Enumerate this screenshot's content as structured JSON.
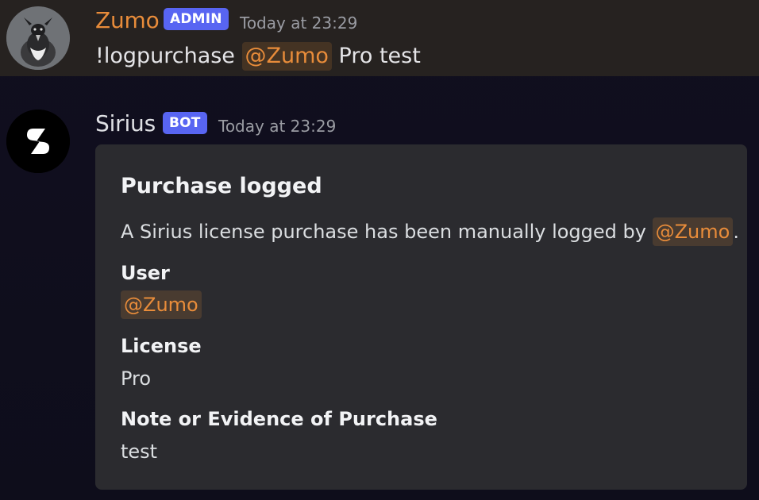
{
  "messages": [
    {
      "author": "Zumo",
      "author_color": "#e88c3a",
      "badge": "ADMIN",
      "timestamp": "Today at 23:29",
      "content_prefix": "!logpurchase",
      "content_mention": "@Zumo",
      "content_suffix": "Pro test",
      "avatar_icon": "bird-avatar-icon",
      "highlighted": true
    },
    {
      "author": "Sirius",
      "badge": "BOT",
      "timestamp": "Today at 23:29",
      "avatar_icon": "sirius-logo-icon",
      "embed": {
        "title": "Purchase logged",
        "description_prefix": "A Sirius license purchase has been manually logged by",
        "description_mention": "@Zumo",
        "description_suffix": ".",
        "fields": [
          {
            "name": "User",
            "value": "@Zumo",
            "is_mention": true
          },
          {
            "name": "License",
            "value": "Pro"
          },
          {
            "name": "Note or Evidence of Purchase",
            "value": "test"
          }
        ]
      }
    }
  ],
  "colors": {
    "badge": "#5865f2",
    "mention_text": "#e88c3a",
    "highlight_background": "#262220",
    "embed_background": "#2b2b2f",
    "app_background": "#0f0e1c"
  }
}
